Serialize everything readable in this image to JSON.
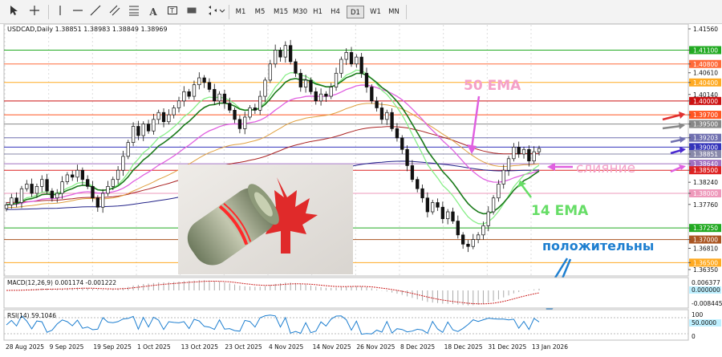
{
  "toolbar": {
    "tools": [
      "cursor-icon",
      "crosshair-icon",
      "horizontal-line-icon",
      "trendline-icon",
      "channel-icon",
      "text-icon",
      "label-icon",
      "shapes-icon"
    ],
    "timeframes": [
      "M1",
      "M5",
      "M15",
      "M30",
      "H1",
      "H4",
      "D1",
      "W1",
      "MN"
    ],
    "active_timeframe": "D1"
  },
  "chart": {
    "header": "USDCAD,Daily  1.38851 1.38983 1.38849 1.38969",
    "price_ticks": [
      "1.41560",
      "1.41100",
      "1.40800",
      "1.40610",
      "1.40400",
      "1.40140",
      "1.40000",
      "1.39700",
      "1.39500",
      "1.39203",
      "1.39000",
      "1.38851",
      "1.38640",
      "1.38500",
      "1.38240",
      "1.38000",
      "1.37760",
      "1.37250",
      "1.37000",
      "1.36810",
      "1.36500",
      "1.36350"
    ],
    "date_ticks": [
      "28 Aug 2025",
      "9 Sep 2025",
      "19 Sep 2025",
      "1 Oct 2025",
      "13 Oct 2025",
      "23 Oct 2025",
      "4 Nov 2025",
      "14 Nov 2025",
      "26 Nov 2025",
      "8 Dec 2025",
      "18 Dec 2025",
      "31 Dec 2025",
      "13 Jan 2026"
    ],
    "levels": [
      {
        "price": "1.41100",
        "color": "#22aa22"
      },
      {
        "price": "1.40800",
        "color": "#ff6a3a"
      },
      {
        "price": "1.40400",
        "color": "#ffaa22"
      },
      {
        "price": "1.40000",
        "color": "#cc1111"
      },
      {
        "price": "1.39700",
        "color": "#ff5522"
      },
      {
        "price": "1.39500",
        "color": "#888888"
      },
      {
        "price": "1.39203",
        "color": "#7070b0"
      },
      {
        "price": "1.39000",
        "color": "#3333bb"
      },
      {
        "price": "1.38851",
        "color": "#8888aa"
      },
      {
        "price": "1.38640",
        "color": "#a070c0"
      },
      {
        "price": "1.38500",
        "color": "#dd2222"
      },
      {
        "price": "1.38000",
        "color": "#ee99bb"
      },
      {
        "price": "1.37250",
        "color": "#22aa22"
      },
      {
        "price": "1.37000",
        "color": "#aa5522"
      },
      {
        "price": "1.36500",
        "color": "#ffaa22"
      }
    ]
  },
  "annotations": {
    "ema50": "50 EMA",
    "merge": "слияние",
    "ema14": "14 EMA",
    "positive": "положительны"
  },
  "macd": {
    "label": "MACD(12,26,9) 0.001174 -0.001222",
    "ticks": [
      "0.006377",
      "0.000000",
      "-0.008445"
    ]
  },
  "rsi": {
    "label": "RSI(14) 59.1046",
    "ticks": [
      "100",
      "50.0000",
      "0"
    ]
  },
  "colors": {
    "candles": "#111111",
    "ema14": "#1a7a1a",
    "ema_light_green": "#88ee88",
    "ema50_pink": "#e060e0",
    "ma_orange": "#e0a040",
    "ma_dark_red": "#aa2222",
    "ma_navy": "#222288",
    "annotation_pink": "#f4a0c8",
    "annotation_green": "#66dd66",
    "annotation_blue": "#1e7fd0"
  },
  "image_placeholder": "canadian-dollar-roll-photo"
}
